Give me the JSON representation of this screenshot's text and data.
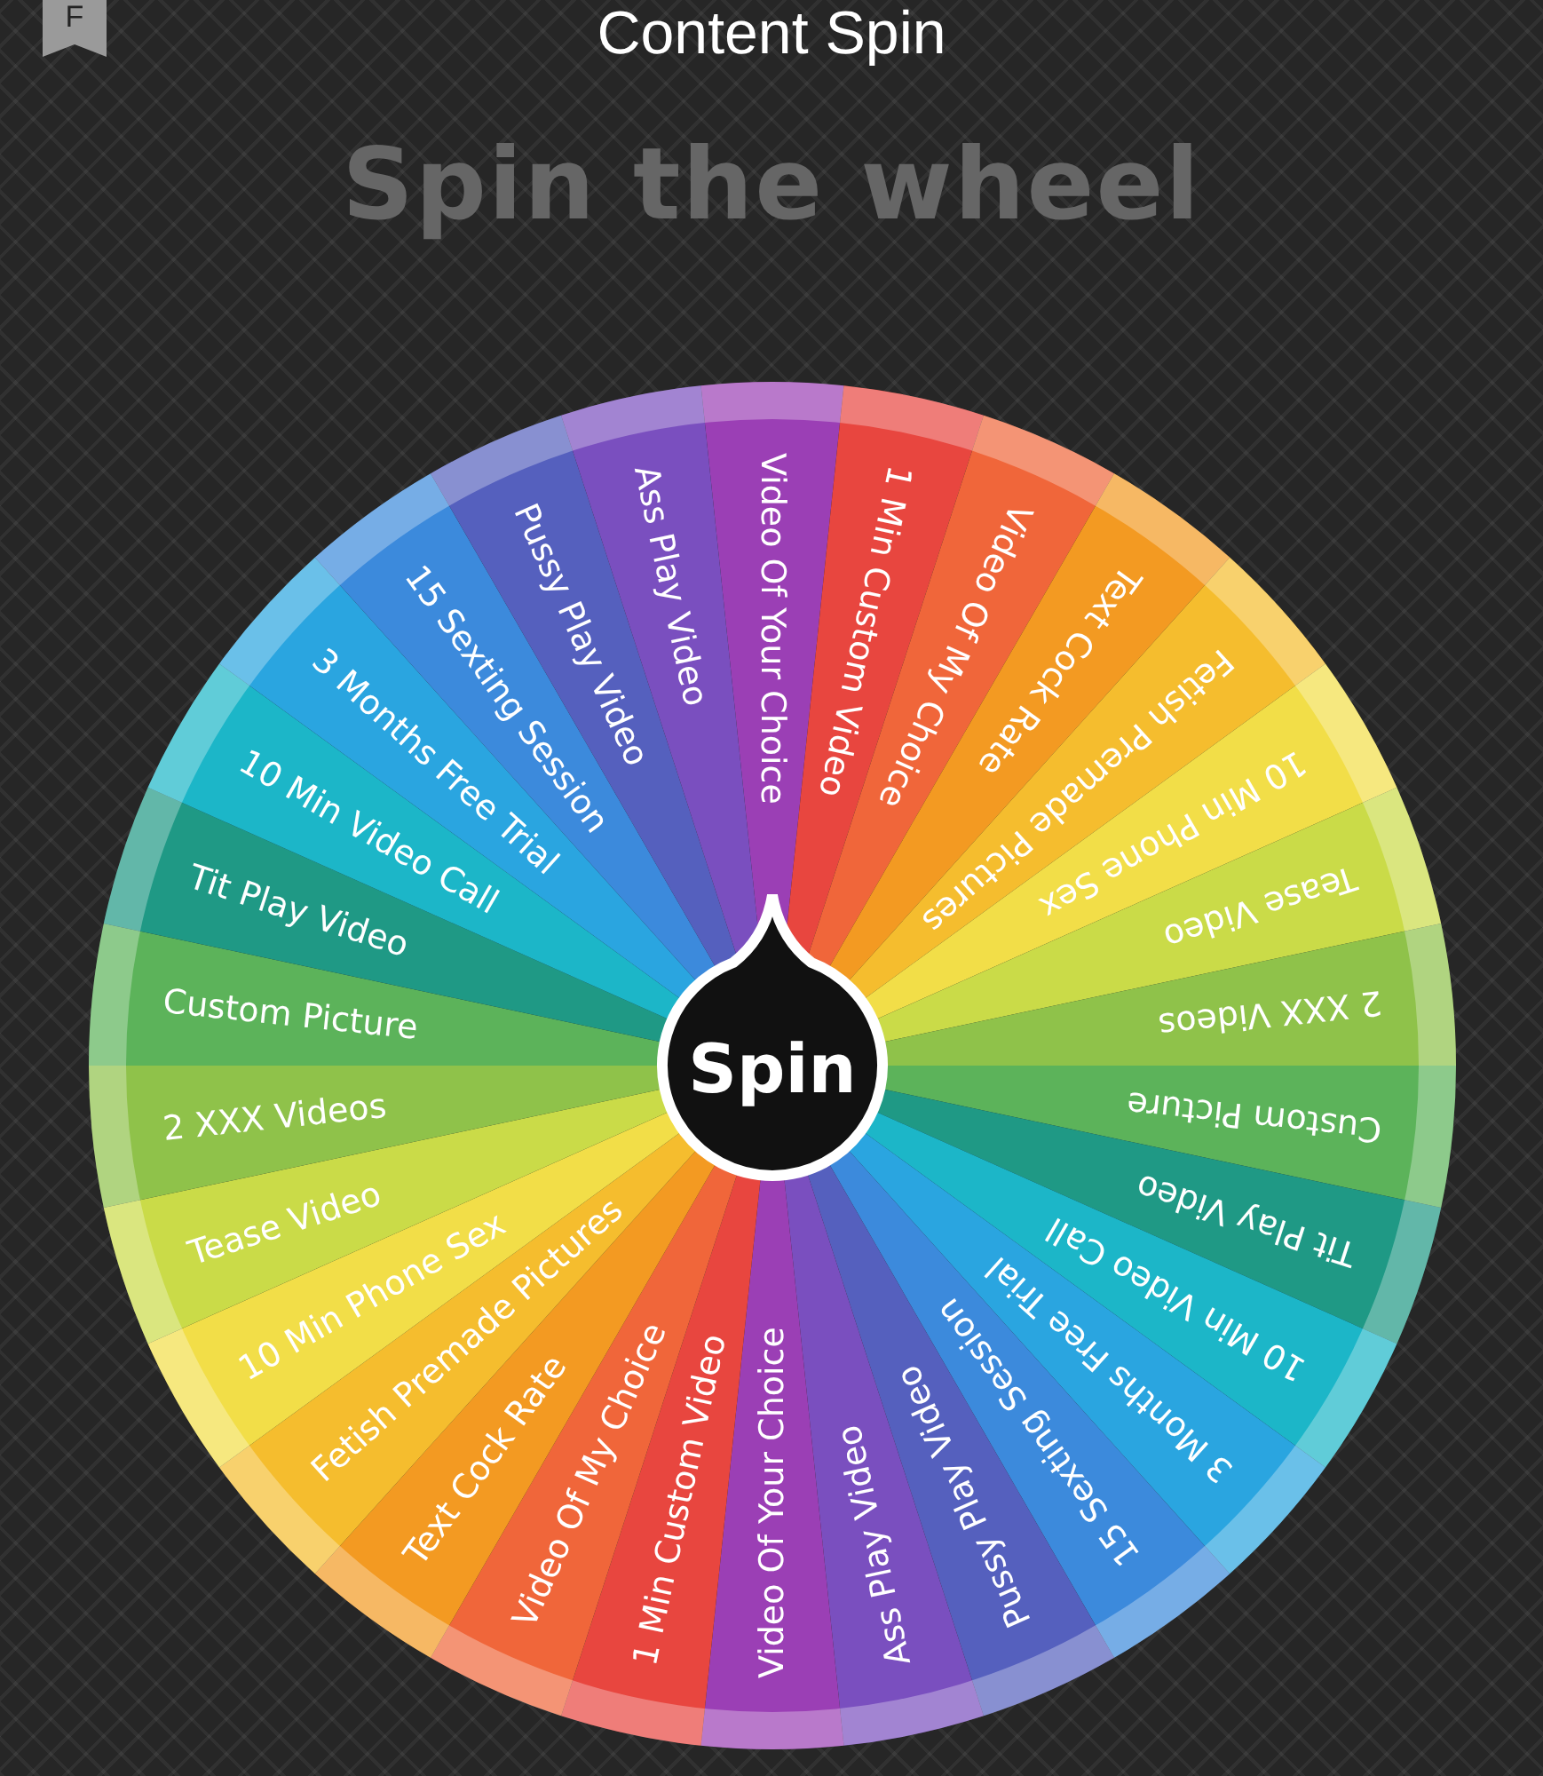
{
  "header": {
    "bookmark_letter": "F",
    "title": "Content Spin"
  },
  "heading": "Spin the wheel",
  "wheel": {
    "button": "Spin",
    "segments": [
      {
        "label": "Video Of Your Choice",
        "color": "#9b3fb5"
      },
      {
        "label": "1 Min Custom Video",
        "color": "#e8463f"
      },
      {
        "label": "Video Of My Choice",
        "color": "#f0663a"
      },
      {
        "label": "Text Cock Rate",
        "color": "#f39a22"
      },
      {
        "label": "Fetish Premade Pictures",
        "color": "#f5bd2e"
      },
      {
        "label": "10 Min Phone Sex",
        "color": "#f2de48"
      },
      {
        "label": "Tease Video",
        "color": "#cadb48"
      },
      {
        "label": "2 XXX Videos",
        "color": "#8fc24a"
      },
      {
        "label": "Custom Picture",
        "color": "#5cb35a"
      },
      {
        "label": "Tit Play Video",
        "color": "#1f9985"
      },
      {
        "label": "10 Min Video Call",
        "color": "#1cb6c8"
      },
      {
        "label": "3 Months Free Trial",
        "color": "#2aa5e0"
      },
      {
        "label": "15 Sexting Session",
        "color": "#3c8adc"
      },
      {
        "label": "Pussy Play Video",
        "color": "#5560be"
      },
      {
        "label": "Ass Play Video",
        "color": "#7a4fbf"
      },
      {
        "label": "Video Of Your Choice",
        "color": "#9b3fb5"
      },
      {
        "label": "1 Min Custom Video",
        "color": "#e8463f"
      },
      {
        "label": "Video Of My Choice",
        "color": "#f0663a"
      },
      {
        "label": "Text Cock Rate",
        "color": "#f39a22"
      },
      {
        "label": "Fetish Premade Pictures",
        "color": "#f5bd2e"
      },
      {
        "label": "10 Min Phone Sex",
        "color": "#f2de48"
      },
      {
        "label": "Tease Video",
        "color": "#cadb48"
      },
      {
        "label": "2 XXX Videos",
        "color": "#8fc24a"
      },
      {
        "label": "Custom Picture",
        "color": "#5cb35a"
      },
      {
        "label": "Tit Play Video",
        "color": "#1f9985"
      },
      {
        "label": "10 Min Video Call",
        "color": "#1cb6c8"
      },
      {
        "label": "3 Months Free Trial",
        "color": "#2aa5e0"
      },
      {
        "label": "15 Sexting Session",
        "color": "#3c8adc"
      },
      {
        "label": "Pussy Play Video",
        "color": "#5560be"
      },
      {
        "label": "Ass Play Video",
        "color": "#7a4fbf"
      }
    ]
  }
}
